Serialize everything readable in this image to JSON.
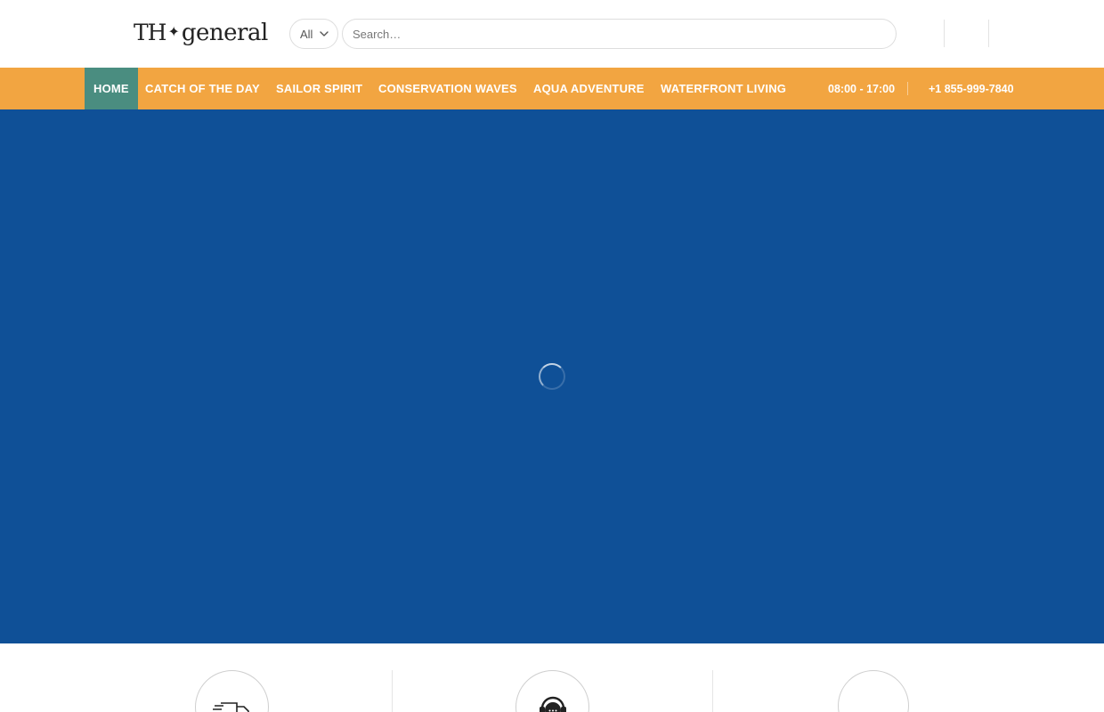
{
  "header": {
    "logo": {
      "part1": "TH",
      "star": "✦",
      "part2": "general"
    },
    "category_select": {
      "selected": "All"
    },
    "search": {
      "placeholder": "Search…",
      "value": ""
    }
  },
  "nav": {
    "items": [
      {
        "label": "HOME",
        "active": true
      },
      {
        "label": "CATCH OF THE DAY"
      },
      {
        "label": "SAILOR SPIRIT"
      },
      {
        "label": "CONSERVATION WAVES"
      },
      {
        "label": "AQUA ADVENTURE"
      },
      {
        "label": "WATERFRONT LIVING"
      }
    ],
    "hours": "08:00 - 17:00",
    "phone": "+1 855-999-7840"
  },
  "colors": {
    "nav_bg": "#f2a541",
    "nav_active_bg": "#4a8d80",
    "hero_bg": "#0f5097"
  },
  "hero": {
    "loading_icon": "spinner-icon"
  },
  "features": [
    {
      "icon": "delivery-truck-icon"
    },
    {
      "icon": "support-headset-icon"
    },
    {
      "icon": "blank-icon"
    }
  ]
}
